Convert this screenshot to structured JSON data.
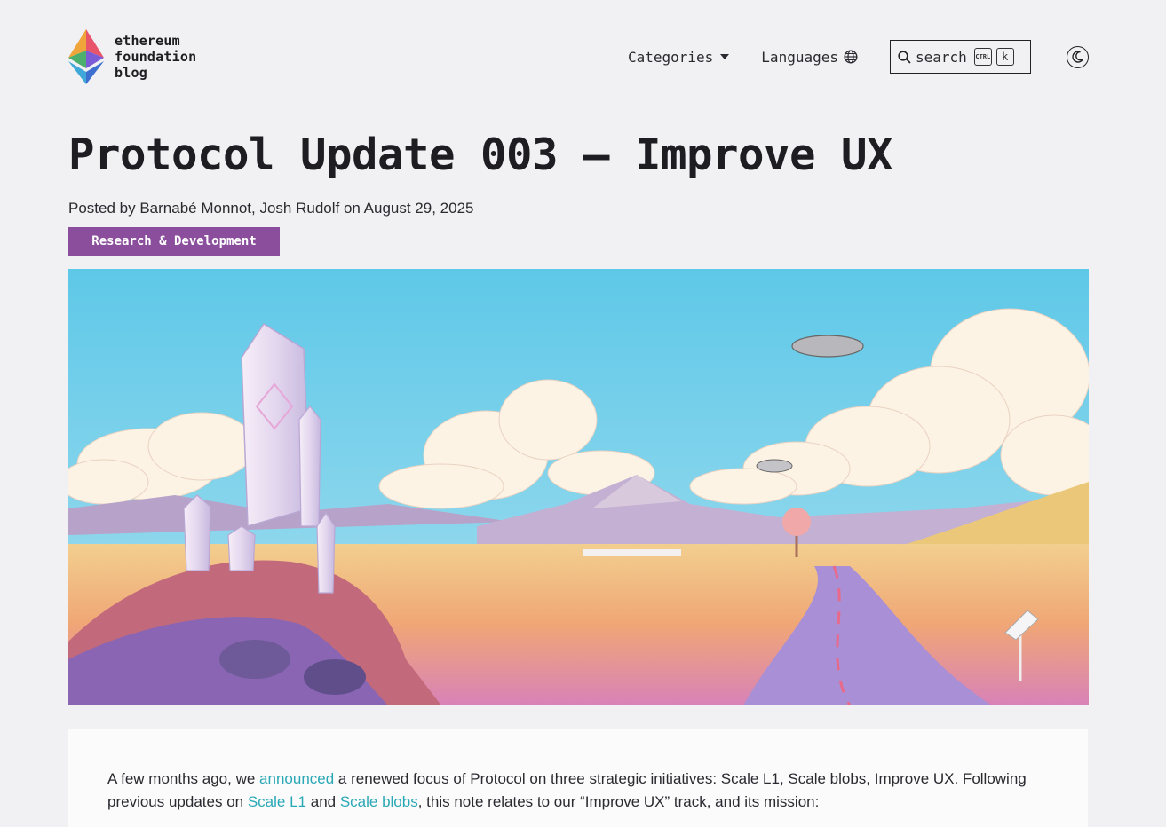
{
  "header": {
    "logo_lines": [
      "ethereum",
      "foundation",
      "blog"
    ],
    "nav": {
      "categories_label": "Categories",
      "languages_label": "Languages",
      "search_label": "search",
      "search_kbd_ctrl": "CTRL",
      "search_kbd_key": "k"
    }
  },
  "post": {
    "title": "Protocol Update 003 — Improve UX",
    "byline": "Posted by Barnabé Monnot, Josh Rudolf on August 29, 2025",
    "tag": "Research & Development"
  },
  "article": {
    "p1_a": "A few months ago, we ",
    "p1_link1": "announced",
    "p1_b": " a renewed focus of Protocol on three strategic initiatives: Scale L1, Scale blobs, Improve UX. Following previous updates on ",
    "p1_link2": "Scale L1",
    "p1_c": " and ",
    "p1_link3": "Scale blobs",
    "p1_d": ", this note relates to our “Improve UX” track, and its mission:"
  },
  "colors": {
    "background": "#f1f0f3",
    "tag_bg": "#8a4e9c",
    "link": "#2aa8b5"
  },
  "icons": [
    "ethereum-logo",
    "caret-down-icon",
    "globe-icon",
    "search-icon",
    "moon-icon"
  ]
}
